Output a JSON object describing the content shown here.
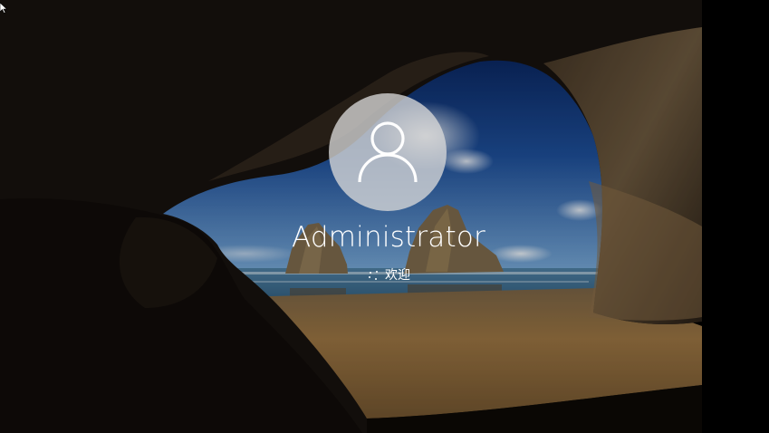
{
  "lock_screen": {
    "username": "Administrator",
    "status_text": "欢迎",
    "avatar_icon": "user-icon",
    "spinner_icon": "loading-spinner-icon",
    "cursor_icon": "mouse-pointer-icon"
  },
  "colors": {
    "background": "#000000",
    "avatar_circle": "#d7d7d7",
    "text": "#ffffff",
    "sky_top": "#0d2f73",
    "sky_horizon": "#6fa8d8",
    "sea": "#3d6f92",
    "sand": "#8a6a3e",
    "rock": "#2a221a"
  }
}
